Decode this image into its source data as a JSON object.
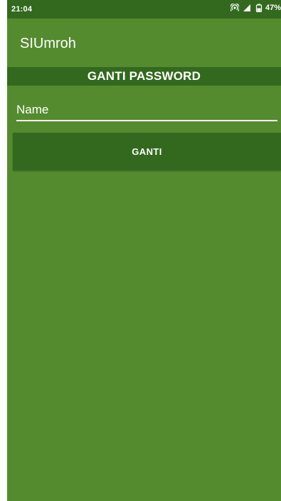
{
  "status_bar": {
    "time": "21:04",
    "battery": "47%",
    "icons": [
      "hotspot-icon",
      "signal-icon",
      "battery-icon"
    ]
  },
  "app_bar": {
    "title": "SIUmroh"
  },
  "section": {
    "title": "GANTI PASSWORD"
  },
  "form": {
    "name_placeholder": "Name",
    "name_value": "",
    "submit_label": "GANTI"
  },
  "colors": {
    "background": "#558b2f",
    "primary_dark": "#33691e",
    "text": "#ffffff"
  }
}
